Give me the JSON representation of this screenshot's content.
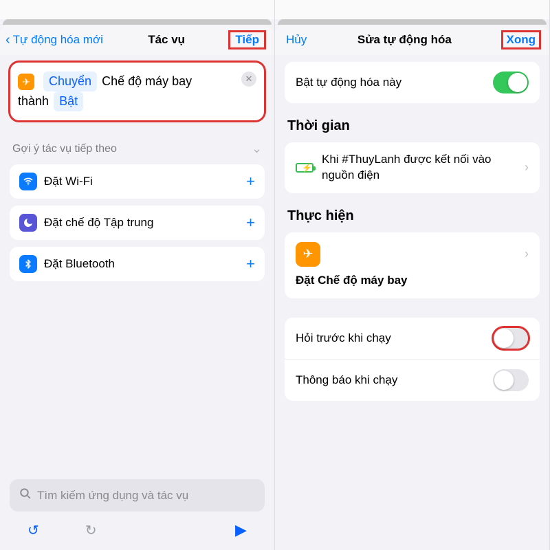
{
  "left": {
    "nav": {
      "back_label": "Tự động hóa mới",
      "title": "Tác vụ",
      "next_label": "Tiếp"
    },
    "action": {
      "verb_token": "Chuyển",
      "middle_text": "Chế độ máy bay",
      "second_line_prefix": "thành",
      "state_token": "Bật"
    },
    "suggest_header": "Gợi ý tác vụ tiếp theo",
    "suggestions": {
      "wifi": "Đặt Wi-Fi",
      "focus": "Đặt chế độ Tập trung",
      "bluetooth": "Đặt Bluetooth"
    },
    "search_placeholder": "Tìm kiếm ứng dụng và tác vụ"
  },
  "right": {
    "nav": {
      "cancel_label": "Hủy",
      "title": "Sửa tự động hóa",
      "done_label": "Xong"
    },
    "enable_label": "Bật tự động hóa này",
    "time_section": "Thời gian",
    "trigger_text": "Khi #ThuyLanh được kết nối vào nguồn điện",
    "do_section": "Thực hiện",
    "do_action_label": "Đặt Chế độ máy bay",
    "ask_label": "Hỏi trước khi chạy",
    "notify_label": "Thông báo khi chạy"
  }
}
